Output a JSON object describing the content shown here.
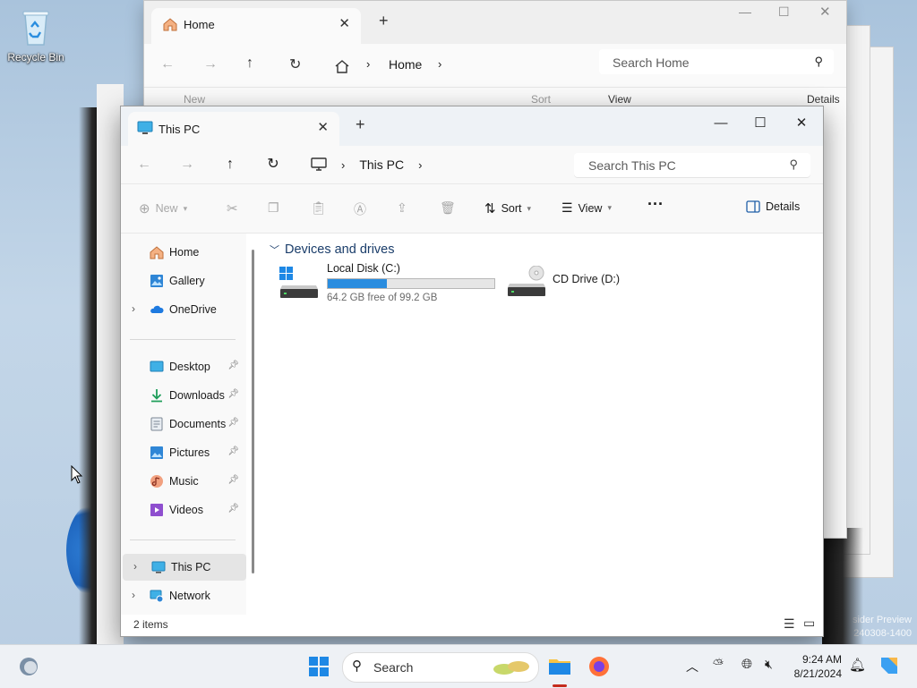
{
  "desktop": {
    "recycle_bin_label": "Recycle Bin",
    "watermark_line1": "sider Preview",
    "watermark_line2": "240308-1400"
  },
  "home_window": {
    "tab_title": "Home",
    "breadcrumb_home": "Home",
    "search_placeholder": "Search Home",
    "cmd_new": "New",
    "cmd_sort": "Sort",
    "cmd_view": "View",
    "cmd_details": "Details"
  },
  "window": {
    "tab_title": "This PC",
    "breadcrumb": "This PC",
    "search_placeholder": "Search This PC",
    "commands": {
      "new": "New",
      "sort": "Sort",
      "view": "View",
      "details": "Details"
    },
    "nav": {
      "home": "Home",
      "gallery": "Gallery",
      "onedrive": "OneDrive",
      "desktop": "Desktop",
      "downloads": "Downloads",
      "documents": "Documents",
      "pictures": "Pictures",
      "music": "Music",
      "videos": "Videos",
      "this_pc": "This PC",
      "network": "Network"
    },
    "group_title": "Devices and drives",
    "drives": [
      {
        "name": "Local Disk (C:)",
        "free_text": "64.2 GB free of 99.2 GB",
        "used_fraction": 0.353
      },
      {
        "name": "CD Drive (D:)"
      }
    ],
    "status_items": "2 items"
  },
  "taskbar": {
    "search_label": "Search",
    "time": "9:24 AM",
    "date": "8/21/2024"
  },
  "colors": {
    "accent": "#2a8ddf",
    "taskbar": "#eef1f5"
  }
}
